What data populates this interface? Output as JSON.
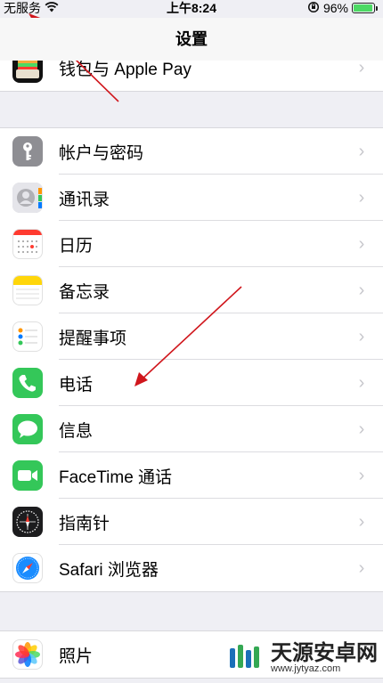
{
  "status_bar": {
    "carrier": "无服务",
    "time": "上午8:24",
    "battery": "96%",
    "battery_level": 0.96,
    "icons": [
      "wifi-icon",
      "rotation-lock-icon",
      "battery-icon"
    ]
  },
  "nav": {
    "title": "设置"
  },
  "group0": [
    {
      "label": "钱包与 Apple Pay",
      "icon": "wallet-icon"
    }
  ],
  "group1": [
    {
      "label": "帐户与密码",
      "icon": "key-icon",
      "color": "#8e8e93"
    },
    {
      "label": "通讯录",
      "icon": "contacts-icon",
      "color": "#c8c8cc"
    },
    {
      "label": "日历",
      "icon": "calendar-icon",
      "color": "#ffffff"
    },
    {
      "label": "备忘录",
      "icon": "notes-icon",
      "color": "#ffd60a"
    },
    {
      "label": "提醒事项",
      "icon": "reminders-icon",
      "color": "#ffffff"
    },
    {
      "label": "电话",
      "icon": "phone-icon",
      "color": "#34c759"
    },
    {
      "label": "信息",
      "icon": "messages-icon",
      "color": "#34c759"
    },
    {
      "label": "FaceTime 通话",
      "icon": "facetime-icon",
      "color": "#34c759"
    },
    {
      "label": "指南针",
      "icon": "compass-icon",
      "color": "#1c1c1e"
    },
    {
      "label": "Safari 浏览器",
      "icon": "safari-icon",
      "color": "#ffffff"
    }
  ],
  "group2": [
    {
      "label": "照片",
      "icon": "photos-icon",
      "color": "#ffffff"
    }
  ],
  "watermark": {
    "name": "天源安卓网",
    "url": "www.jytyaz.com"
  },
  "annotation_color": "#d0161c"
}
